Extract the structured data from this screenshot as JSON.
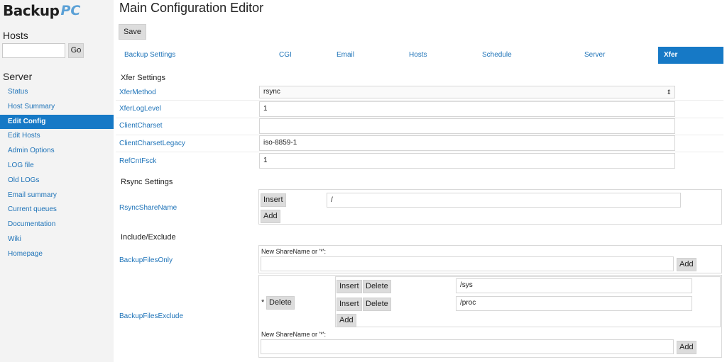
{
  "sidebar": {
    "logo_main": "Backup",
    "logo_pc": "PC",
    "hosts_heading": "Hosts",
    "host_go": "Go",
    "server_heading": "Server",
    "nav": [
      {
        "label": "Status"
      },
      {
        "label": "Host Summary"
      },
      {
        "label": "Edit Config",
        "active": true
      },
      {
        "label": "Edit Hosts"
      },
      {
        "label": "Admin Options"
      },
      {
        "label": "LOG file"
      },
      {
        "label": "Old LOGs"
      },
      {
        "label": "Email summary"
      },
      {
        "label": "Current queues"
      },
      {
        "label": "Documentation"
      },
      {
        "label": "Wiki"
      },
      {
        "label": "Homepage"
      }
    ]
  },
  "main": {
    "title": "Main Configuration Editor",
    "save_label": "Save",
    "tabs": [
      "Backup Settings",
      "CGI",
      "Email",
      "Hosts",
      "Schedule",
      "Server",
      "Xfer"
    ],
    "active_tab": "Xfer",
    "xfer_heading": "Xfer Settings",
    "xfer": {
      "method_label": "XferMethod",
      "method_value": "rsync",
      "loglevel_label": "XferLogLevel",
      "loglevel_value": "1",
      "charset_label": "ClientCharset",
      "charset_value": "",
      "charset_legacy_label": "ClientCharsetLegacy",
      "charset_legacy_value": "iso-8859-1",
      "refcnt_label": "RefCntFsck",
      "refcnt_value": "1"
    },
    "rsync_heading": "Rsync Settings",
    "rsync": {
      "sharename_label": "RsyncShareName",
      "insert_label": "Insert",
      "share_value": "/",
      "add_label": "Add"
    },
    "incl_heading": "Include/Exclude",
    "incl": {
      "only_label": "BackupFilesOnly",
      "new_share_label": "New ShareName or '*':",
      "only_value": "",
      "add_label": "Add",
      "exclude_label": "BackupFilesExclude",
      "star": "*",
      "delete_label": "Delete",
      "insert_label": "Insert",
      "exclude_values": [
        "/sys",
        "/proc"
      ],
      "exclude_new_value": ""
    }
  }
}
